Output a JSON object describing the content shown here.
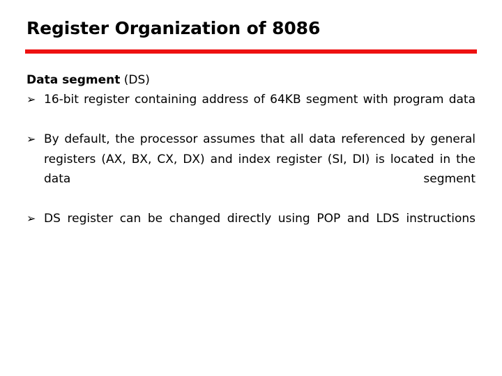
{
  "slide": {
    "title": "Register Organization of 8086",
    "accent_color": "#ee1111",
    "text_color": "#000000",
    "background_color": "#ffffff",
    "heading": {
      "bold_part": "Data segment",
      "plain_part": " (DS)"
    },
    "bullet_marker": "➢",
    "bullets": [
      {
        "text": "16-bit register containing address of 64KB segment with program data",
        "justified": true
      },
      {
        "text": "By default, the processor assumes that all data referenced by general registers (AX, BX, CX, DX) and index register (SI, DI) is located in the data segment",
        "justified": true
      },
      {
        "text": "DS register can be changed directly using POP and LDS instructions",
        "justified": true
      }
    ]
  }
}
